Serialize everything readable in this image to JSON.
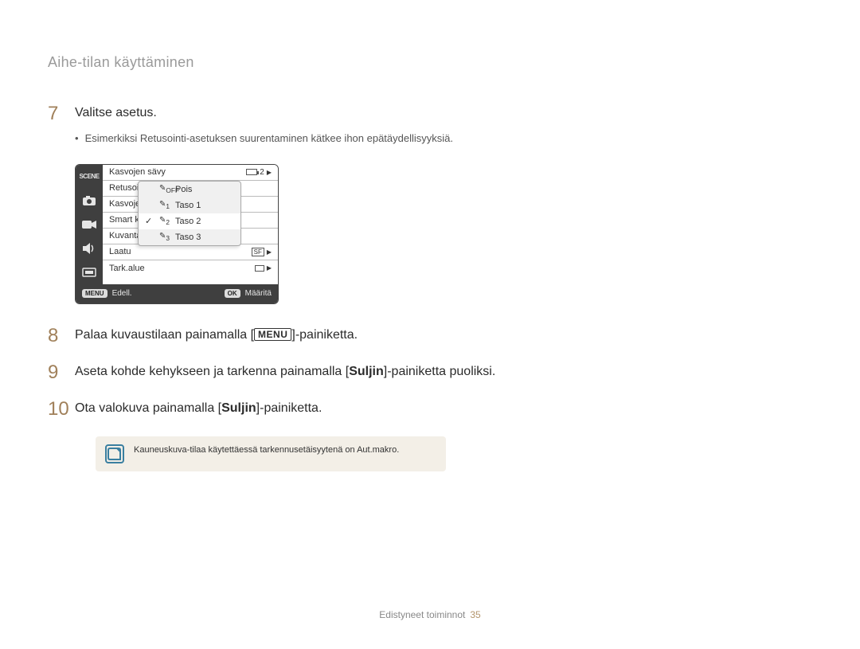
{
  "sectionTitle": "Aihe-tilan käyttäminen",
  "steps": {
    "s7": {
      "num": "7",
      "text": "Valitse asetus.",
      "sub": "Esimerkiksi Retusointi-asetuksen suurentaminen kätkee ihon epätäydellisyyksiä."
    },
    "s8": {
      "num": "8",
      "textBefore": "Palaa kuvaustilaan painamalla [",
      "menuLabel": "MENU",
      "textAfter": "]-painiketta."
    },
    "s9": {
      "num": "9",
      "text": "Aseta kohde kehykseen ja tarkenna painamalla [",
      "bold": "Suljin",
      "textAfter": "]-painiketta puoliksi."
    },
    "s10": {
      "num": "10",
      "text": "Ota valokuva painamalla [",
      "bold": "Suljin",
      "textAfter": "]-painiketta."
    }
  },
  "menu": {
    "rows": [
      "Kasvojen sävy",
      "Retusoin",
      "Kasvojen",
      "Smart ka",
      "Kuvantar",
      "Laatu",
      "Tark.alue"
    ],
    "batteryVal": "2",
    "footer": {
      "menuBtn": "MENU",
      "prevLabel": "Edell.",
      "okBtn": "OK",
      "okLabel": "Määritä"
    }
  },
  "popup": {
    "items": [
      {
        "check": "",
        "sub": "OFF",
        "label": "Pois"
      },
      {
        "check": "",
        "sub": "1",
        "label": "Taso 1"
      },
      {
        "check": "✓",
        "sub": "2",
        "label": "Taso 2"
      },
      {
        "check": "",
        "sub": "3",
        "label": "Taso 3"
      }
    ]
  },
  "note": "Kauneuskuva-tilaa käytettäessä tarkennusetäisyytenä on Aut.makro.",
  "footerText": "Edistyneet toiminnot",
  "footerPage": "35"
}
